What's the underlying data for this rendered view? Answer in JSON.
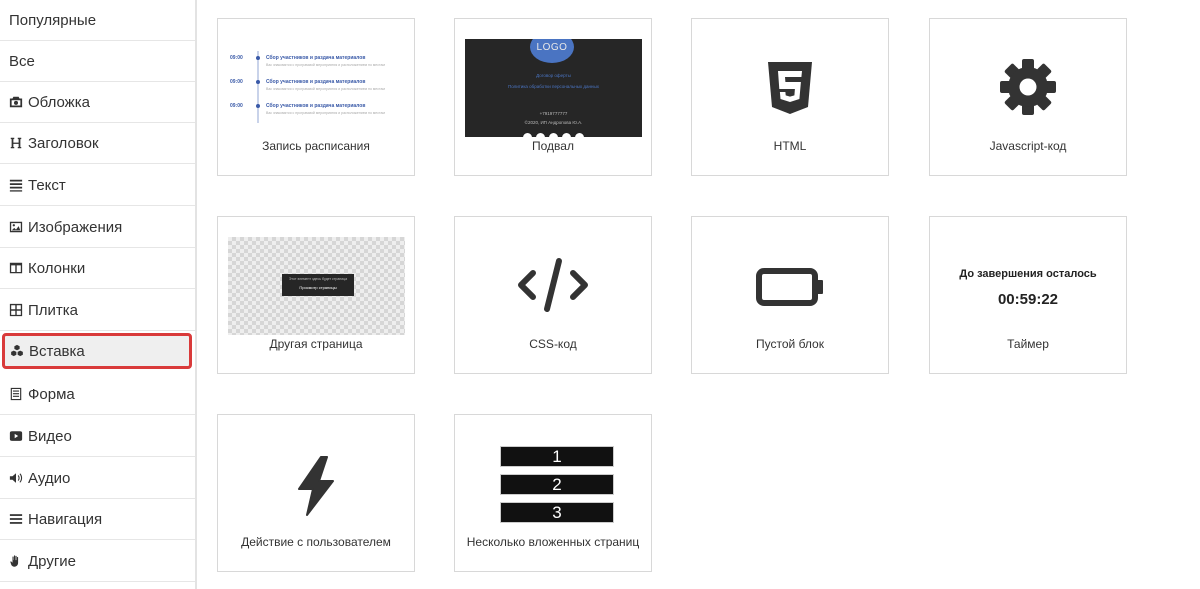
{
  "sidebar": {
    "items": [
      {
        "label": "Популярные",
        "icon": ""
      },
      {
        "label": "Все",
        "icon": ""
      },
      {
        "label": "Обложка",
        "icon": "camera-icon"
      },
      {
        "label": "Заголовок",
        "icon": "heading-icon"
      },
      {
        "label": "Текст",
        "icon": "align-justify-icon"
      },
      {
        "label": "Изображения",
        "icon": "image-icon"
      },
      {
        "label": "Колонки",
        "icon": "columns-icon"
      },
      {
        "label": "Плитка",
        "icon": "grid-icon"
      },
      {
        "label": "Вставка",
        "icon": "cubes-icon"
      },
      {
        "label": "Форма",
        "icon": "form-icon"
      },
      {
        "label": "Видео",
        "icon": "youtube-icon"
      },
      {
        "label": "Аудио",
        "icon": "volume-icon"
      },
      {
        "label": "Навигация",
        "icon": "bars-icon"
      },
      {
        "label": "Другие",
        "icon": "hand-icon"
      }
    ],
    "active_index": 8,
    "active_color": "#d93a3a"
  },
  "cards": [
    {
      "label": "Запись расписания",
      "icon": "schedule-thumbnail"
    },
    {
      "label": "Подвал",
      "icon": "footer-thumbnail"
    },
    {
      "label": "HTML",
      "icon": "html5-icon"
    },
    {
      "label": "Javascript-код",
      "icon": "gear-icon"
    },
    {
      "label": "Другая страница",
      "icon": "other-page-thumbnail"
    },
    {
      "label": "CSS-код",
      "icon": "code-icon"
    },
    {
      "label": "Пустой блок",
      "icon": "battery-empty-icon"
    },
    {
      "label": "Таймер",
      "icon": "timer-thumbnail"
    },
    {
      "label": "Действие с пользователем",
      "icon": "bolt-icon"
    },
    {
      "label": "Несколько вложенных страниц",
      "icon": "numbered-pages-thumbnail"
    }
  ],
  "schedule_thumb": {
    "rows": [
      {
        "time": "09:00",
        "title": "Сбор участников и раздача материалов",
        "desc": "Вас знакомятся с программой мероприятия и расположением по местам"
      },
      {
        "time": "09:00",
        "title": "Сбор участников и раздача материалов",
        "desc": "Вас знакомятся с программой мероприятия и расположением по местам"
      },
      {
        "time": "09:00",
        "title": "Сбор участников и раздача материалов",
        "desc": "Вас знакомятся с программой мероприятия и расположением по местам"
      }
    ]
  },
  "footer_thumb": {
    "logo": "LOGO",
    "line1": "Договор оферты",
    "line2": "Политика обработки персональных данных",
    "phone": "+7919777777",
    "copyright": "©2020, ИП Андропова Ю.А."
  },
  "other_page_thumb": {
    "text": "Этот элемент здесь будет страница",
    "button": "Просмотр страницы"
  },
  "timer_thumb": {
    "title": "До завершения осталось",
    "time": "00:59:22"
  },
  "nested_pages_thumb": {
    "numbers": [
      "1",
      "2",
      "3"
    ]
  }
}
